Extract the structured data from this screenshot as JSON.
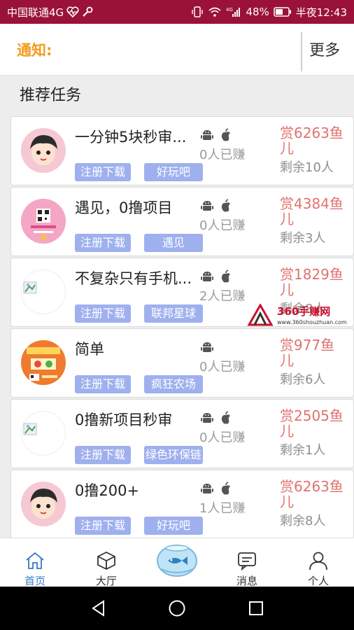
{
  "status_bar": {
    "carrier": "中国联通4G",
    "battery": "48%",
    "time": "半夜12:43",
    "signal_label": "4G"
  },
  "notice": {
    "label": "通知:",
    "more": "更多"
  },
  "section_title": "推荐任务",
  "tasks": [
    {
      "title": "一分钟5块秒审...",
      "earned": "0人已赚",
      "reward": "赏6263鱼儿",
      "remaining": "剩余10人",
      "register": "注册下载",
      "tag": "好玩吧",
      "android": true,
      "ios": true
    },
    {
      "title": "遇见，0撸项目",
      "earned": "0人已赚",
      "reward": "赏4384鱼儿",
      "remaining": "剩余3人",
      "register": "注册下载",
      "tag": "遇见",
      "android": true,
      "ios": true
    },
    {
      "title": "不复杂只有手机...",
      "earned": "2人已赚",
      "reward": "赏1829鱼儿",
      "remaining": "剩余8人",
      "register": "注册下载",
      "tag": "联邦星球",
      "android": true,
      "ios": true
    },
    {
      "title": "简单",
      "earned": "0人已赚",
      "reward": "赏977鱼儿",
      "remaining": "剩余6人",
      "register": "注册下载",
      "tag": "疯狂农场",
      "android": true,
      "ios": false
    },
    {
      "title": "0撸新项目秒审",
      "earned": "0人已赚",
      "reward": "赏2505鱼儿",
      "remaining": "剩余1人",
      "register": "注册下载",
      "tag": "绿色环保链",
      "android": true,
      "ios": true
    },
    {
      "title": "0撸200+",
      "earned": "1人已赚",
      "reward": "赏6263鱼儿",
      "remaining": "剩余8人",
      "register": "注册下载",
      "tag": "好玩吧",
      "android": true,
      "ios": true
    }
  ],
  "watermark": {
    "text": "360手赚网",
    "url": "www.360shouzhuan.com"
  },
  "tabbar": [
    {
      "label": "首页",
      "icon": "home-icon",
      "active": true
    },
    {
      "label": "大厅",
      "icon": "cube-icon",
      "active": false
    },
    {
      "label": "",
      "icon": "fishbowl-icon",
      "active": false
    },
    {
      "label": "消息",
      "icon": "message-icon",
      "active": false
    },
    {
      "label": "个人",
      "icon": "person-icon",
      "active": false
    }
  ],
  "colors": {
    "status_bar": "#9a1238",
    "notice": "#f39a1b",
    "reward": "#e0726f",
    "button": "#9fb0ee",
    "tab_active": "#3a78c8"
  }
}
